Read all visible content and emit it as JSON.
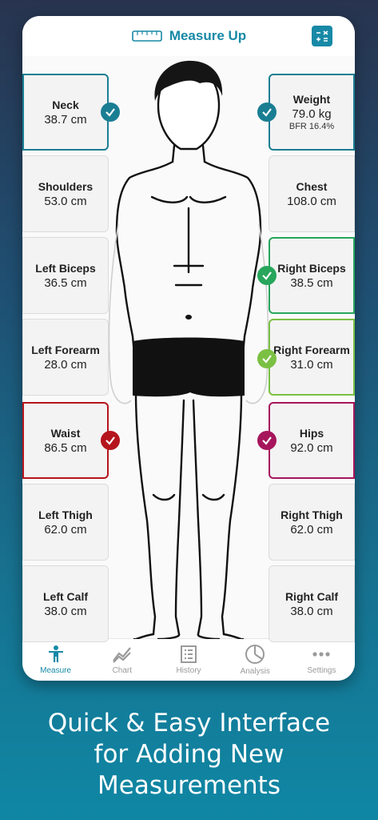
{
  "app": {
    "title": "Measure Up"
  },
  "cards_left": [
    {
      "label": "Neck",
      "value": "38.7 cm"
    },
    {
      "label": "Shoulders",
      "value": "53.0 cm"
    },
    {
      "label": "Left Biceps",
      "value": "36.5 cm"
    },
    {
      "label": "Left Forearm",
      "value": "28.0 cm"
    },
    {
      "label": "Waist",
      "value": "86.5 cm"
    },
    {
      "label": "Left Thigh",
      "value": "62.0 cm"
    },
    {
      "label": "Left Calf",
      "value": "38.0 cm"
    }
  ],
  "cards_right": [
    {
      "label": "Weight",
      "value": "79.0 kg",
      "sub": "BFR 16.4%"
    },
    {
      "label": "Chest",
      "value": "108.0 cm"
    },
    {
      "label": "Right Biceps",
      "value": "38.5 cm"
    },
    {
      "label": "Right Forearm",
      "value": "31.0 cm"
    },
    {
      "label": "Hips",
      "value": "92.0 cm"
    },
    {
      "label": "Right Thigh",
      "value": "62.0 cm"
    },
    {
      "label": "Right Calf",
      "value": "38.0 cm"
    }
  ],
  "colors": {
    "accent": "#1789a6",
    "neck_status": "#1a7e93",
    "weight_status": "#1a7e93",
    "right_biceps_status": "#27a65c",
    "right_forearm_status": "#7bc043",
    "waist_status": "#b5151d",
    "hips_status": "#a6155c"
  },
  "icons": {
    "header_left": "tape-measure-icon",
    "header_right": "calculator-icon"
  },
  "tabs": [
    {
      "label": "Measure",
      "icon": "person-icon",
      "active": true
    },
    {
      "label": "Chart",
      "icon": "chart-icon",
      "active": false
    },
    {
      "label": "History",
      "icon": "history-icon",
      "active": false
    },
    {
      "label": "Analysis",
      "icon": "analysis-icon",
      "active": false
    },
    {
      "label": "Settings",
      "icon": "more-icon",
      "active": false
    }
  ],
  "caption": {
    "line1": "Quick & Easy Interface",
    "line2": "for Adding New",
    "line3": "Measurements"
  }
}
